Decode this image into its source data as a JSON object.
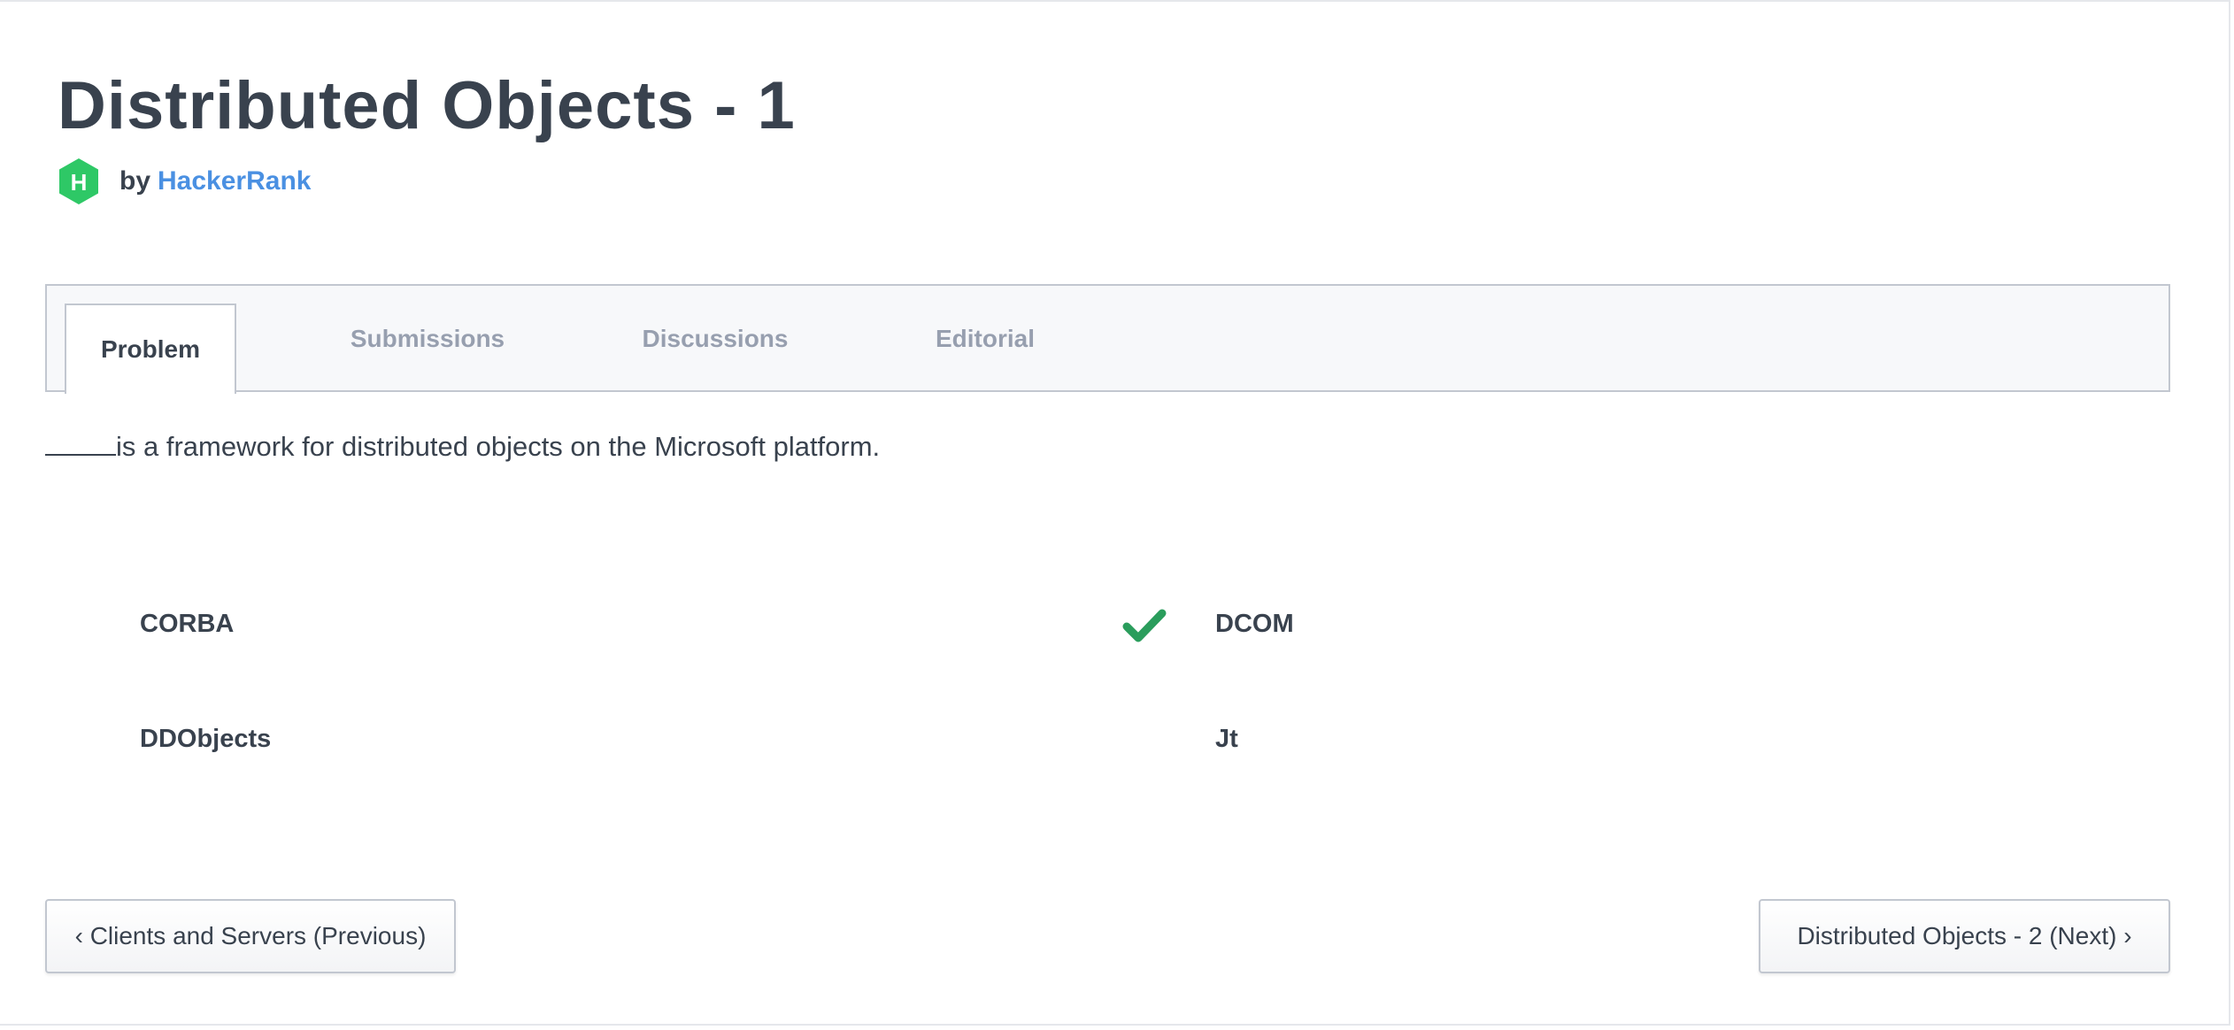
{
  "page": {
    "title": "Distributed Objects - 1"
  },
  "author": {
    "by_label": "by",
    "name": "HackerRank",
    "logo_icon": "hackerrank-logo",
    "logo_letter": "H",
    "logo_color": "#2ec866",
    "link_color": "#4a90e2"
  },
  "tabs": [
    {
      "label": "Problem",
      "active": true
    },
    {
      "label": "Submissions",
      "active": false
    },
    {
      "label": "Discussions",
      "active": false
    },
    {
      "label": "Editorial",
      "active": false
    }
  ],
  "question": {
    "text": "is a framework for distributed objects on the Microsoft platform."
  },
  "options": [
    {
      "label": "CORBA",
      "correct": false
    },
    {
      "label": "DCOM",
      "correct": true
    },
    {
      "label": "DDObjects",
      "correct": false
    },
    {
      "label": "Jt",
      "correct": false
    }
  ],
  "check_icon": {
    "name": "checkmark-icon",
    "color": "#2a9d5c"
  },
  "navigation": {
    "previous_label": "‹ Clients and Servers (Previous)",
    "next_label": "Distributed Objects - 2 (Next) ›"
  }
}
